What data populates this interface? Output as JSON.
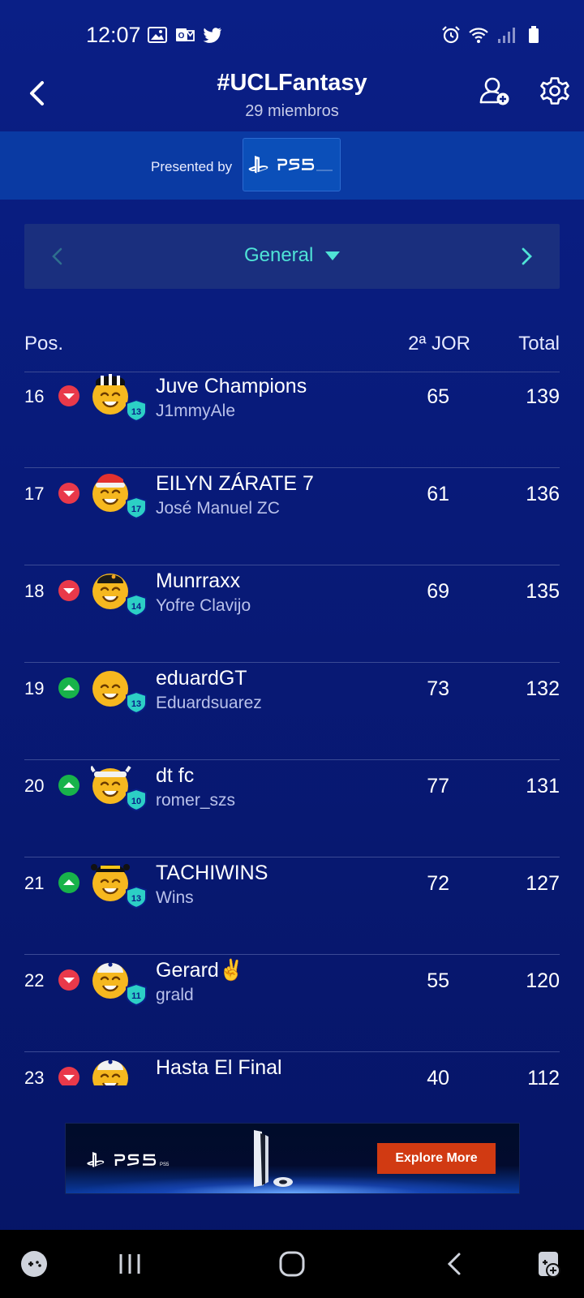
{
  "status_bar": {
    "time": "12:07",
    "left_icons": [
      "gallery-icon",
      "outlook-icon",
      "twitter-icon"
    ],
    "right_icons": [
      "alarm-icon",
      "wifi-icon",
      "signal-icon",
      "battery-icon"
    ]
  },
  "header": {
    "title": "#UCLFantasy",
    "subtitle": "29 miembros"
  },
  "sponsor": {
    "presented_by": "Presented by",
    "brand": "PS5"
  },
  "selector": {
    "label": "General"
  },
  "table": {
    "col_pos": "Pos.",
    "col_round": "2ª JOR",
    "col_total": "Total"
  },
  "rows": [
    {
      "pos": "16",
      "trend": "down",
      "team": "Juve Champions",
      "manager": "J1mmyAle",
      "round": "65",
      "total": "139",
      "level": "13",
      "hat": "stripes"
    },
    {
      "pos": "17",
      "trend": "down",
      "team": "EILYN ZÁRATE 7",
      "manager": "José Manuel ZC",
      "round": "61",
      "total": "136",
      "level": "17",
      "hat": "santa"
    },
    {
      "pos": "18",
      "trend": "down",
      "team": "Munrraxx",
      "manager": "Yofre Clavijo",
      "round": "69",
      "total": "135",
      "level": "14",
      "hat": "cap"
    },
    {
      "pos": "19",
      "trend": "up",
      "team": "eduardGT",
      "manager": "Eduardsuarez",
      "round": "73",
      "total": "132",
      "level": "13",
      "hat": "none"
    },
    {
      "pos": "20",
      "trend": "up",
      "team": "dt fc",
      "manager": "romer_szs",
      "round": "77",
      "total": "131",
      "level": "10",
      "hat": "headband"
    },
    {
      "pos": "21",
      "trend": "up",
      "team": "TACHIWINS",
      "manager": "Wins",
      "round": "72",
      "total": "127",
      "level": "13",
      "hat": "bee"
    },
    {
      "pos": "22",
      "trend": "down",
      "team": "Gerard✌️",
      "manager": "grald",
      "round": "55",
      "total": "120",
      "level": "11",
      "hat": "white"
    },
    {
      "pos": "23",
      "trend": "down",
      "team": "Hasta El Final",
      "manager": "",
      "round": "40",
      "total": "112",
      "level": "",
      "hat": "white"
    }
  ],
  "ad": {
    "brand": "PS5",
    "cta": "Explore More"
  },
  "nav": [
    "game-launcher-icon",
    "recent-apps-icon",
    "home-icon",
    "back-icon",
    "game-tools-icon"
  ]
}
